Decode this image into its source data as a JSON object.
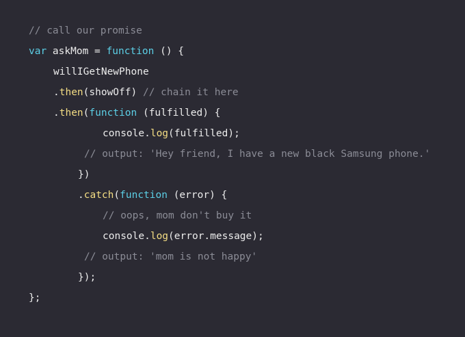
{
  "editor": {
    "background": "#2b2a33",
    "colors": {
      "comment": "#8b8c96",
      "keyword": "#5ccfe6",
      "function": "#f4dd84",
      "plain": "#ececec"
    },
    "lines": [
      {
        "tokens": [
          {
            "type": "comment",
            "text": "// call our promise"
          }
        ]
      },
      {
        "tokens": [
          {
            "type": "keyword",
            "text": "var"
          },
          {
            "type": "plain",
            "text": " askMom = "
          },
          {
            "type": "keyword",
            "text": "function"
          },
          {
            "type": "plain",
            "text": " () {"
          }
        ]
      },
      {
        "tokens": [
          {
            "type": "plain",
            "text": "willIGetNewPhone"
          }
        ]
      },
      {
        "tokens": [
          {
            "type": "plain",
            "text": "."
          },
          {
            "type": "func",
            "text": "then"
          },
          {
            "type": "plain",
            "text": "(showOff) "
          },
          {
            "type": "comment",
            "text": "// chain it here"
          }
        ]
      },
      {
        "tokens": [
          {
            "type": "plain",
            "text": "."
          },
          {
            "type": "func",
            "text": "then"
          },
          {
            "type": "plain",
            "text": "("
          },
          {
            "type": "keyword",
            "text": "function"
          },
          {
            "type": "plain",
            "text": " (fulfilled) {"
          }
        ]
      },
      {
        "tokens": [
          {
            "type": "plain",
            "text": "console."
          },
          {
            "type": "func",
            "text": "log"
          },
          {
            "type": "plain",
            "text": "(fulfilled);"
          }
        ]
      },
      {
        "tokens": [
          {
            "type": "comment",
            "text": "// output: 'Hey friend, I have a new black Samsung phone.'"
          }
        ]
      },
      {
        "tokens": [
          {
            "type": "plain",
            "text": "})"
          }
        ]
      },
      {
        "tokens": [
          {
            "type": "plain",
            "text": "."
          },
          {
            "type": "func",
            "text": "catch"
          },
          {
            "type": "plain",
            "text": "("
          },
          {
            "type": "keyword",
            "text": "function"
          },
          {
            "type": "plain",
            "text": " (error) {"
          }
        ]
      },
      {
        "tokens": [
          {
            "type": "comment",
            "text": "// oops, mom don't buy it"
          }
        ]
      },
      {
        "tokens": [
          {
            "type": "plain",
            "text": "console."
          },
          {
            "type": "func",
            "text": "log"
          },
          {
            "type": "plain",
            "text": "(error.message);"
          }
        ]
      },
      {
        "tokens": [
          {
            "type": "comment",
            "text": "// output: 'mom is not happy'"
          }
        ]
      },
      {
        "tokens": [
          {
            "type": "plain",
            "text": "});"
          }
        ]
      },
      {
        "tokens": [
          {
            "type": "plain",
            "text": "};"
          }
        ]
      }
    ]
  }
}
